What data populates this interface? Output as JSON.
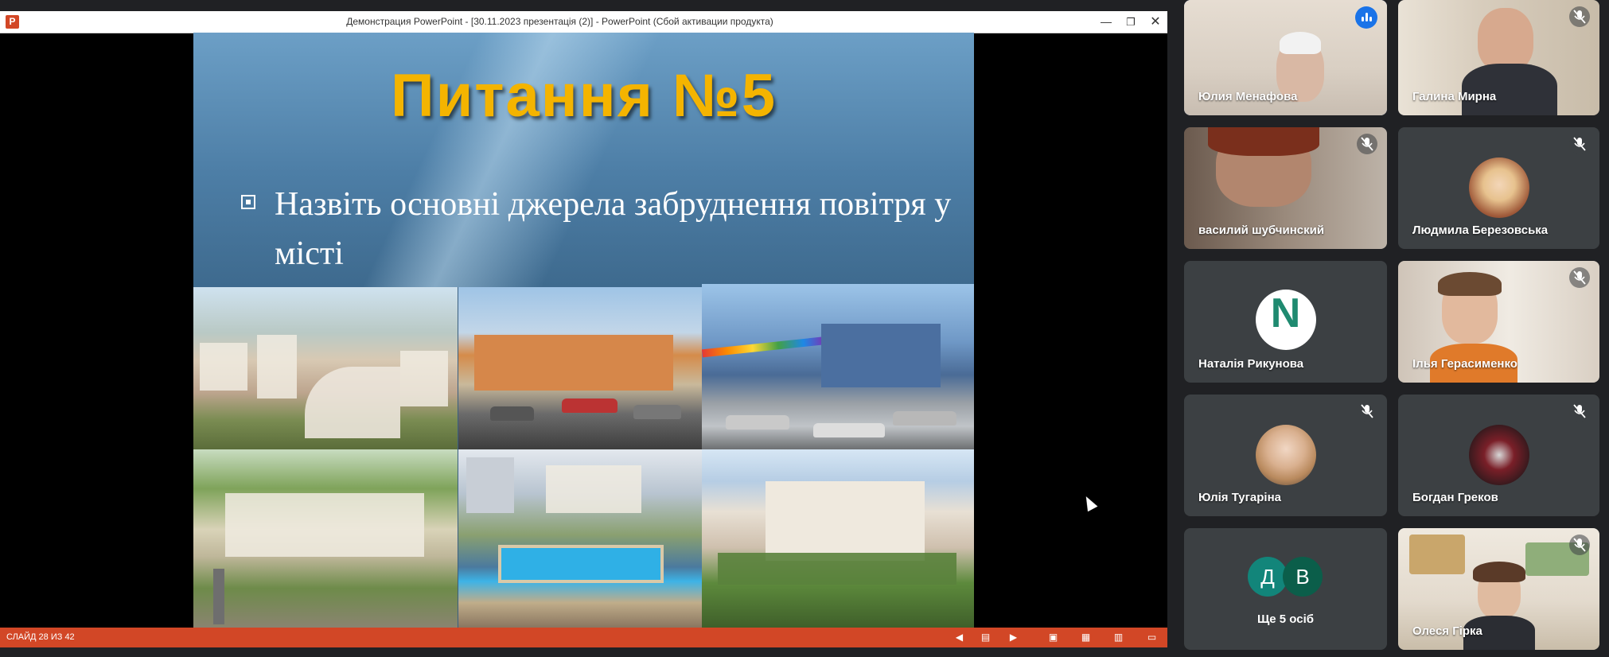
{
  "ppt": {
    "logo": "P",
    "window_title": "Демонстрация PowerPoint - [30.11.2023 презентація (2)] - PowerPoint (Сбой активации продукта)",
    "status_slide": "СЛАЙД 28 ИЗ 42",
    "window_controls": {
      "minimize": "—",
      "restore": "❐",
      "close": "✕"
    }
  },
  "slide": {
    "title": "Питання №5",
    "bullet": "Назвіть основні джерела забруднення повітря у місті",
    "photos": [
      "city-panorama-photo",
      "square-with-cars-photo",
      "street-traffic-photo",
      "government-building-photo",
      "fountain-photo",
      "monument-building-photo"
    ]
  },
  "statusbar_icons": [
    "prev-icon",
    "slides-icon",
    "next-icon",
    "normal-view-icon",
    "slide-sorter-icon",
    "reading-view-icon",
    "slideshow-icon"
  ],
  "participants": [
    {
      "name": "Юлия Менафова",
      "kind": "video",
      "speaking": true
    },
    {
      "name": "Галина Мирна",
      "kind": "video",
      "muted": true
    },
    {
      "name": "василий шубчинский",
      "kind": "video",
      "muted": true
    },
    {
      "name": "Людмила Березовська",
      "kind": "avatar",
      "muted": true
    },
    {
      "name": "Наталія Рикунова",
      "kind": "logo",
      "logo_letter": "N"
    },
    {
      "name": "Ілья Герасименко",
      "kind": "video",
      "muted": true
    },
    {
      "name": "Юлія Тугаріна",
      "kind": "avatar",
      "muted": true
    },
    {
      "name": "Богдан Греков",
      "kind": "avatar",
      "muted": true
    },
    {
      "label": "Ще 5 осіб",
      "letters": [
        "Д",
        "В"
      ],
      "letter_colors": [
        "#12857a",
        "#0b5e4a"
      ]
    },
    {
      "name": "Олеся Гірка",
      "kind": "video",
      "muted": true
    }
  ],
  "colors": {
    "ppt_accent": "#d24726",
    "title_yellow": "#f4b400",
    "meet_bg": "#202124",
    "tile_bg": "#3c4043",
    "speaking_blue": "#1a73e8"
  }
}
